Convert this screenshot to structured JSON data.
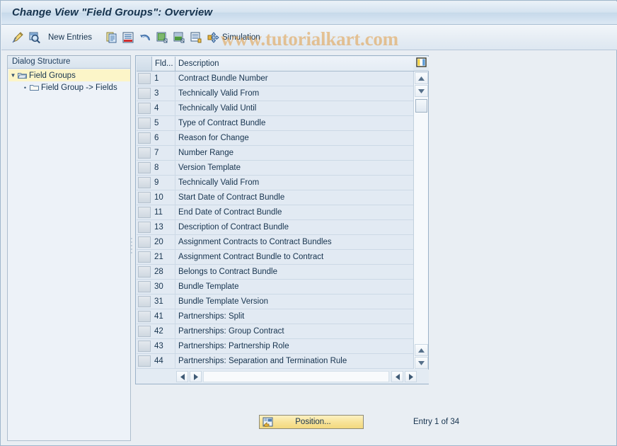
{
  "window": {
    "title": "Change View \"Field Groups\": Overview"
  },
  "watermark": {
    "text": "www.tutorialkart.com",
    "color": "#e0973a"
  },
  "toolbar": {
    "items": [
      {
        "icon": "pencil-display-change-icon",
        "label": ""
      },
      {
        "icon": "magnifier-details-icon",
        "label": ""
      },
      {
        "icon": "new-entries-label",
        "label": "New Entries"
      },
      {
        "icon": "copy-as-icon",
        "label": ""
      },
      {
        "icon": "delete-row-icon",
        "label": ""
      },
      {
        "icon": "undo-icon",
        "label": ""
      },
      {
        "icon": "select-all-icon",
        "label": ""
      },
      {
        "icon": "select-block-icon",
        "label": ""
      },
      {
        "icon": "deselect-all-icon",
        "label": ""
      },
      {
        "icon": "simulation-arrows-icon",
        "label": "Simulation"
      }
    ],
    "new_entries_label": "New Entries",
    "simulation_label": "Simulation"
  },
  "sidebar": {
    "header": "Dialog Structure",
    "items": [
      {
        "label": "Field Groups",
        "icon": "open-folder-icon",
        "expander": "▼",
        "selected": true,
        "indent": 0
      },
      {
        "label": "Field Group -> Fields",
        "icon": "folder-icon",
        "expander": "•",
        "selected": false,
        "indent": 1
      }
    ]
  },
  "table": {
    "columns": [
      {
        "key": "select",
        "label": ""
      },
      {
        "key": "fld",
        "label": "Fld..."
      },
      {
        "key": "description",
        "label": "Description"
      }
    ],
    "config_icon": "table-settings-icon",
    "rows": [
      {
        "fld": "1",
        "description": "Contract Bundle Number"
      },
      {
        "fld": "3",
        "description": "Technically Valid From"
      },
      {
        "fld": "4",
        "description": "Technically Valid Until"
      },
      {
        "fld": "5",
        "description": "Type of Contract Bundle"
      },
      {
        "fld": "6",
        "description": "Reason for Change"
      },
      {
        "fld": "7",
        "description": "Number Range"
      },
      {
        "fld": "8",
        "description": "Version Template"
      },
      {
        "fld": "9",
        "description": "Technically Valid From"
      },
      {
        "fld": "10",
        "description": "Start Date of Contract Bundle"
      },
      {
        "fld": "11",
        "description": "End Date of Contract Bundle"
      },
      {
        "fld": "13",
        "description": "Description of Contract Bundle"
      },
      {
        "fld": "20",
        "description": "Assignment Contracts to Contract Bundles"
      },
      {
        "fld": "21",
        "description": "Assignment Contract Bundle to Contract"
      },
      {
        "fld": "28",
        "description": "Belongs to Contract Bundle"
      },
      {
        "fld": "30",
        "description": "Bundle Template"
      },
      {
        "fld": "31",
        "description": "Bundle Template Version"
      },
      {
        "fld": "41",
        "description": "Partnerships: Split"
      },
      {
        "fld": "42",
        "description": "Partnerships: Group Contract"
      },
      {
        "fld": "43",
        "description": "Partnerships: Partnership Role"
      },
      {
        "fld": "44",
        "description": "Partnerships: Separation and Termination Rule"
      }
    ]
  },
  "footer": {
    "position_label": "Position...",
    "position_icon": "position-jump-icon",
    "entry_count": "Entry 1 of 34"
  }
}
